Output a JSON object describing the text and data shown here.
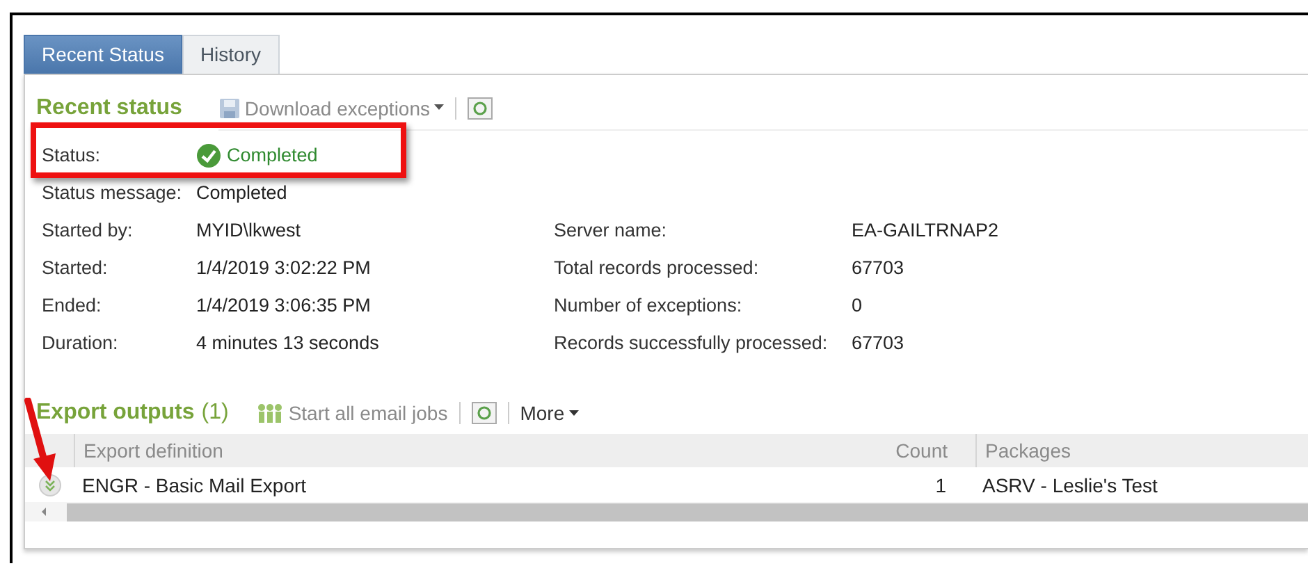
{
  "tabs": [
    {
      "label": "Recent Status",
      "selected": true
    },
    {
      "label": "History",
      "selected": false
    }
  ],
  "recent_status": {
    "title": "Recent status",
    "download_label": "Download exceptions",
    "status": {
      "label": "Status:",
      "value": "Completed"
    },
    "left_details": [
      {
        "label": "Status message:",
        "value": "Completed"
      },
      {
        "label": "Started by:",
        "value": "MYID\\lkwest"
      },
      {
        "label": "Started:",
        "value": "1/4/2019 3:02:22 PM"
      },
      {
        "label": "Ended:",
        "value": "1/4/2019 3:06:35 PM"
      },
      {
        "label": "Duration:",
        "value": "4 minutes 13 seconds"
      }
    ],
    "right_details": [
      {
        "label": "Server name:",
        "value": "EA-GAILTRNAP2"
      },
      {
        "label": "Total records processed:",
        "value": "67703"
      },
      {
        "label": "Number of exceptions:",
        "value": "0"
      },
      {
        "label": "Records successfully processed:",
        "value": "67703"
      }
    ]
  },
  "export_outputs": {
    "title": "Export outputs",
    "count": "(1)",
    "start_label": "Start all email jobs",
    "more_label": "More",
    "columns": [
      "Export definition",
      "Count",
      "Packages"
    ],
    "rows": [
      {
        "definition": "ENGR - Basic Mail Export",
        "count": "1",
        "packages": "ASRV - Leslie's Test"
      }
    ]
  }
}
